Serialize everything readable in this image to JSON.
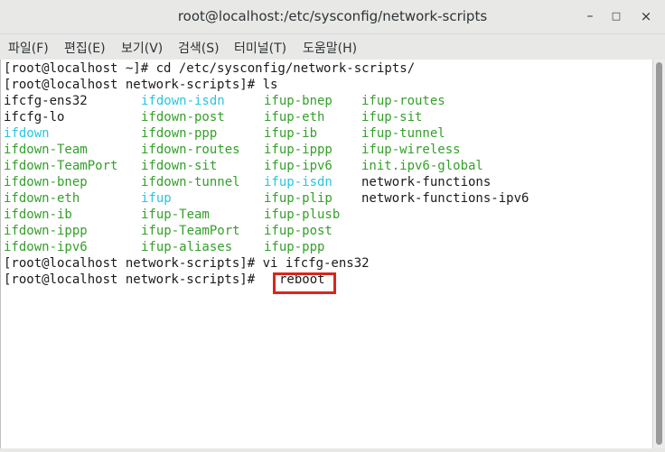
{
  "window": {
    "title": "root@localhost:/etc/sysconfig/network-scripts"
  },
  "window_buttons": {
    "minimize": "–",
    "maximize": "□",
    "close": "×"
  },
  "menu": {
    "items": [
      "파일(F)",
      "편집(E)",
      "보기(V)",
      "검색(S)",
      "터미널(T)",
      "도움말(H)"
    ]
  },
  "terminal": {
    "prompt_lines": [
      "[root@localhost ~]# cd /etc/sysconfig/network-scripts/",
      "[root@localhost network-scripts]# ls"
    ],
    "ls_rows": [
      [
        {
          "t": "ifcfg-ens32",
          "c": "default"
        },
        {
          "t": "ifdown-isdn",
          "c": "cyan"
        },
        {
          "t": "ifup-bnep",
          "c": "green"
        },
        {
          "t": "ifup-routes",
          "c": "green"
        }
      ],
      [
        {
          "t": "ifcfg-lo",
          "c": "default"
        },
        {
          "t": "ifdown-post",
          "c": "green"
        },
        {
          "t": "ifup-eth",
          "c": "green"
        },
        {
          "t": "ifup-sit",
          "c": "green"
        }
      ],
      [
        {
          "t": "ifdown",
          "c": "cyan"
        },
        {
          "t": "ifdown-ppp",
          "c": "green"
        },
        {
          "t": "ifup-ib",
          "c": "green"
        },
        {
          "t": "ifup-tunnel",
          "c": "green"
        }
      ],
      [
        {
          "t": "ifdown-Team",
          "c": "green"
        },
        {
          "t": "ifdown-routes",
          "c": "green"
        },
        {
          "t": "ifup-ippp",
          "c": "green"
        },
        {
          "t": "ifup-wireless",
          "c": "green"
        }
      ],
      [
        {
          "t": "ifdown-TeamPort",
          "c": "green"
        },
        {
          "t": "ifdown-sit",
          "c": "green"
        },
        {
          "t": "ifup-ipv6",
          "c": "green"
        },
        {
          "t": "init.ipv6-global",
          "c": "green"
        }
      ],
      [
        {
          "t": "ifdown-bnep",
          "c": "green"
        },
        {
          "t": "ifdown-tunnel",
          "c": "green"
        },
        {
          "t": "ifup-isdn",
          "c": "cyan"
        },
        {
          "t": "network-functions",
          "c": "default"
        }
      ],
      [
        {
          "t": "ifdown-eth",
          "c": "green"
        },
        {
          "t": "ifup",
          "c": "cyan"
        },
        {
          "t": "ifup-plip",
          "c": "green"
        },
        {
          "t": "network-functions-ipv6",
          "c": "default"
        }
      ],
      [
        {
          "t": "ifdown-ib",
          "c": "green"
        },
        {
          "t": "ifup-Team",
          "c": "green"
        },
        {
          "t": "ifup-plusb",
          "c": "green"
        },
        {
          "t": "",
          "c": "default"
        }
      ],
      [
        {
          "t": "ifdown-ippp",
          "c": "green"
        },
        {
          "t": "ifup-TeamPort",
          "c": "green"
        },
        {
          "t": "ifup-post",
          "c": "green"
        },
        {
          "t": "",
          "c": "default"
        }
      ],
      [
        {
          "t": "ifdown-ipv6",
          "c": "green"
        },
        {
          "t": "ifup-aliases",
          "c": "green"
        },
        {
          "t": "ifup-ppp",
          "c": "green"
        },
        {
          "t": "",
          "c": "default"
        }
      ]
    ],
    "after_lines": [
      "[root@localhost network-scripts]# vi ifcfg-ens32",
      "[root@localhost network-scripts]# "
    ],
    "current_command": "reboot"
  },
  "colors": {
    "green": "#34a02a",
    "cyan": "#28c6e0",
    "text": "#1a1a1a",
    "highlight": "#d9261c"
  }
}
